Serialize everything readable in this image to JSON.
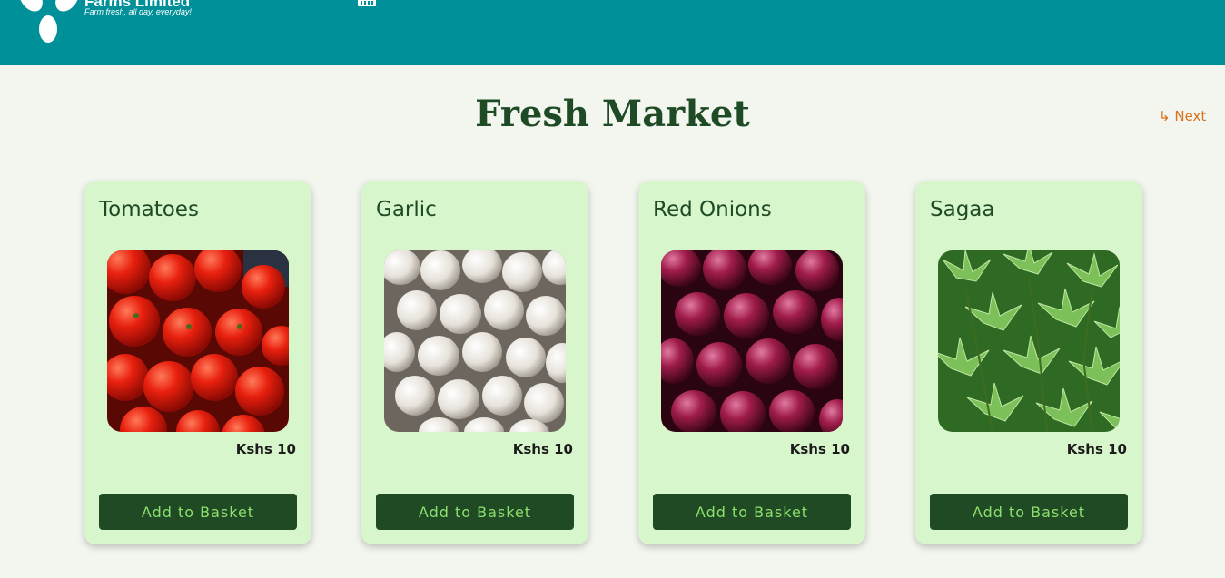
{
  "brand": {
    "name": "Farms Limited",
    "tagline": "Farm fresh, all day, everyday!",
    "logo_icon": "leaf-logo-icon",
    "basket_icon": "basket-icon"
  },
  "colors": {
    "header": "#00909a",
    "background": "#f2f6ef",
    "card": "#d8f6cc",
    "button": "#1f4a24",
    "button_text": "#8de06e",
    "title": "#1e4a26",
    "link": "#d9701e"
  },
  "main": {
    "title": "Fresh Market",
    "next_arrow": "↳",
    "next_label": "Next"
  },
  "products": [
    {
      "name": "Tomatoes",
      "price": "Kshs 10",
      "button_label": "Add to Basket",
      "image": "tomatoes-photo"
    },
    {
      "name": "Garlic",
      "price": "Kshs 10",
      "button_label": "Add to Basket",
      "image": "garlic-photo"
    },
    {
      "name": "Red Onions",
      "price": "Kshs 10",
      "button_label": "Add to Basket",
      "image": "red-onions-photo"
    },
    {
      "name": "Sagaa",
      "price": "Kshs 10",
      "button_label": "Add to Basket",
      "image": "sagaa-greens-photo"
    }
  ]
}
